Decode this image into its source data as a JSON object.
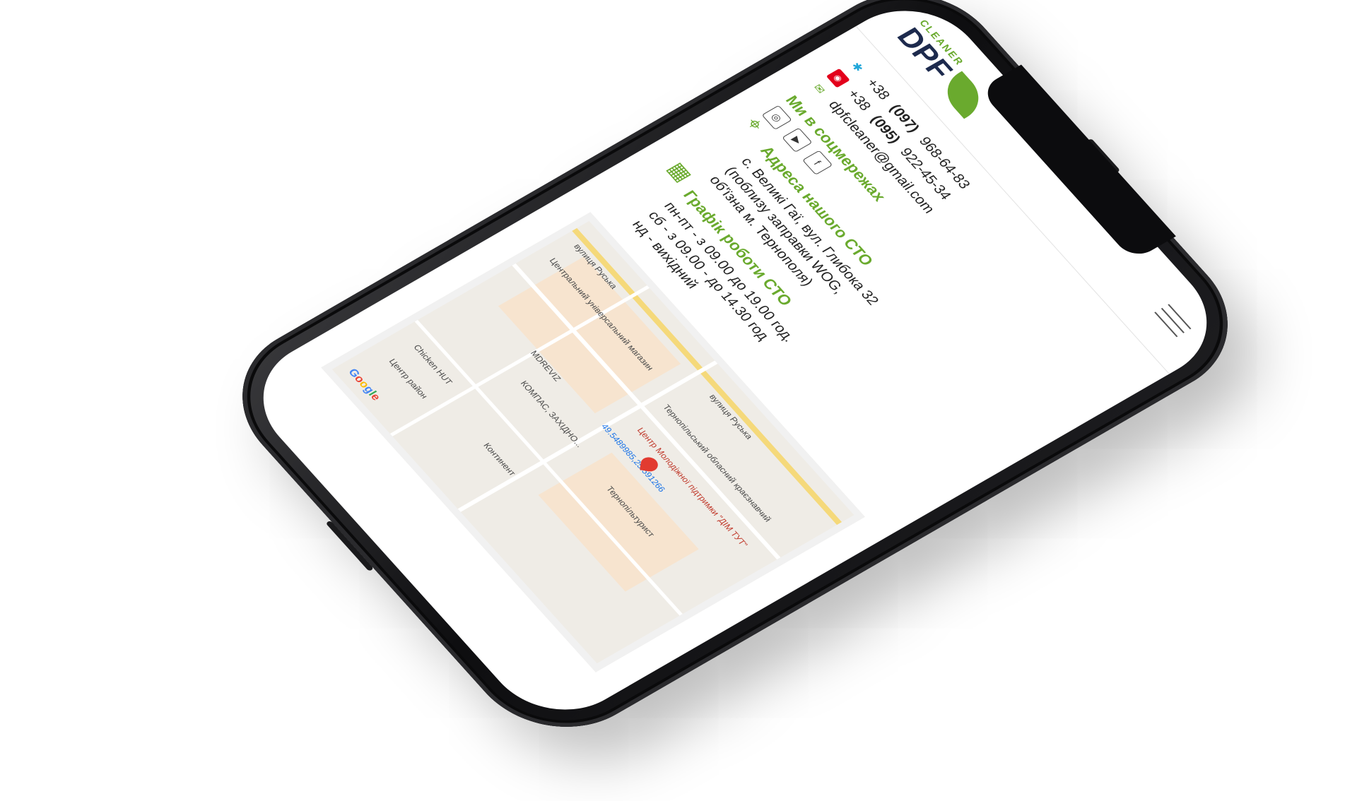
{
  "header": {
    "logo_main": "DPF",
    "logo_sub": "CLEANER"
  },
  "contacts": {
    "phone1_prefix": "+38",
    "phone1_code": "(097)",
    "phone1_number": "968-64-83",
    "phone2_prefix": "+38",
    "phone2_code": "(095)",
    "phone2_number": "922-45-34",
    "email": "dpfcleaner@gmail.com"
  },
  "social": {
    "title": "Ми в соцмережах",
    "items": [
      "instagram",
      "youtube",
      "facebook"
    ]
  },
  "address": {
    "title": "Адреса нашого СТО",
    "line1": "с. Великі Гаї, вул. Глибока 32",
    "line2": "(поблизу заправки WOG,",
    "line3": "об'їзна м. Тернополя)"
  },
  "schedule": {
    "title": "Графік роботи СТО",
    "line1": "пн-пт - з 09.00 до 19.00 год.",
    "line2": "сб - з 09.00 - до 14.30 год",
    "line3": "нд - вихідний"
  },
  "map": {
    "street1": "вулиця Руська",
    "street2": "вулиця Руська",
    "poi1": "Центральний універсальний магазин",
    "poi2": "Тернопільський обласний краєзнавчий",
    "poi3": "Центр Молодіжної підтримки \"ДІМ ТУТ\"",
    "poi4": "Тернопільтурист",
    "poi5": "КОМПАС, ЗАХІДНО...",
    "poi6": "MDREVIZ",
    "poi7": "Континент",
    "poi8": "Chicken HUT",
    "poi9": "Центр район",
    "coords": "49.5489985,25.591266",
    "google": "Google"
  }
}
